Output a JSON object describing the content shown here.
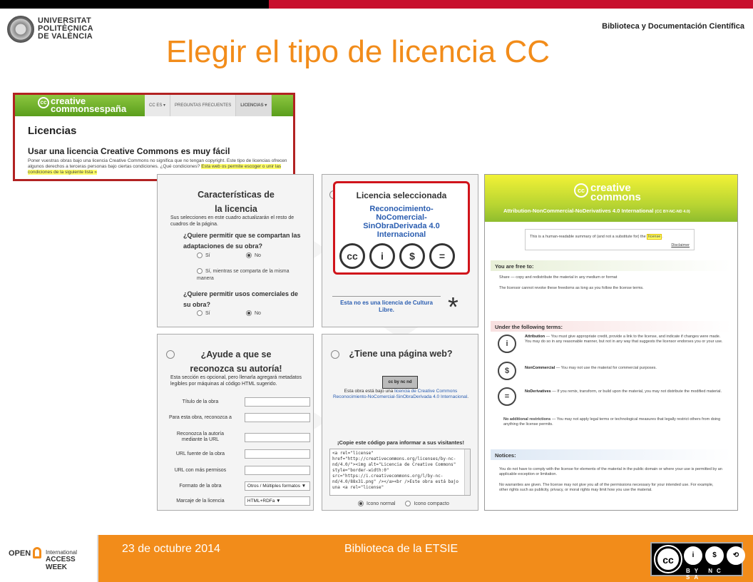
{
  "header": {
    "university": "UNIVERSITAT\nPOLITÈCNICA\nDE VALÈNCIA",
    "library": "Biblioteca y Documentación Científica",
    "title": "Elegir el tipo de licencia CC"
  },
  "ccspain": {
    "logo_top": "creative",
    "logo_bottom": "commonsespaña",
    "logo_cc": "cc",
    "tabs": [
      "CC ES",
      "PREGUNTAS FRECUENTES",
      "LICENCIAS"
    ],
    "heading": "Licencias",
    "subheading": "Usar una licencia Creative Commons es muy fácil",
    "body": "Poner vuestras obras bajo una licencia Creative Commons no significa que no tengan copyright. Este tipo de licencias ofrecen algunos derechos a terceras personas bajo ciertas condiciones. ¿Qué condiciones?",
    "highlight": "Esta web os permite escoger o unir las condiciones de la siguiente lista »"
  },
  "characteristics": {
    "title": "Características de la licencia",
    "intro": "Sus selecciones en este cuadro actualizarán el resto de cuadros de la página.",
    "q1": "¿Quiere permitir que se compartan las adaptaciones de su obra?",
    "q1_options": [
      "Sí",
      "No",
      "Sí, mientras se comparta de la misma manera"
    ],
    "q1_selected": "No",
    "q2": "¿Quiere permitir usos comerciales de su obra?",
    "q2_options": [
      "Sí",
      "No"
    ],
    "q2_selected": "No"
  },
  "selected": {
    "title": "Licencia seleccionada",
    "name": "Reconocimiento-NoComercial-SinObraDerivada 4.0 Internacional",
    "icons": [
      "cc",
      "by",
      "nc",
      "nd"
    ],
    "icon_glyphs": [
      "cc",
      "i",
      "$",
      "="
    ],
    "culture_note": "Esta no es una licencia de Cultura Libre.",
    "star": "*"
  },
  "authorship": {
    "title": "¿Ayude a que se reconozca su autoría!",
    "intro": "Esta sección es opcional, pero llenarla agregará metadatos legibles por máquinas al código HTML sugerido.",
    "fields": [
      {
        "label": "Título de la obra",
        "value": ""
      },
      {
        "label": "Para esta obra, reconozca a",
        "value": ""
      },
      {
        "label": "Reconozca la autoría mediante la URL",
        "value": ""
      },
      {
        "label": "URL fuente de la obra",
        "value": ""
      },
      {
        "label": "URL con más permisos",
        "value": ""
      },
      {
        "label": "Formato de la obra",
        "value": "Otros / Múltiples formatos ▼"
      },
      {
        "label": "Marcaje de la licencia",
        "value": "HTML+RDFa ▼"
      }
    ]
  },
  "website": {
    "title": "¿Tiene una página web?",
    "badge": "cc by nc nd",
    "text_prefix": "Esta obra está bajo una",
    "text_link": "licencia de Creative Commons Reconocimiento-NoComercial-SinObraDerivada 4.0 Internacional",
    "text_suffix": ".",
    "copy_label": "¡Copie este código para informar a sus visitantes!",
    "code": "<a rel=\"license\" href=\"http://creativecommons.org/licenses/by-nc-nd/4.0/\"><img alt=\"Licencia de Creative Commons\" style=\"border-width:0\" src=\"https://i.creativecommons.org/l/by-nc-nd/4.0/88x31.png\" /></a><br />Este obra está bajo una <a rel=\"license\"",
    "options": [
      "Icono normal",
      "Icono compacto"
    ],
    "selected_option": "Icono normal"
  },
  "deed": {
    "logo_top": "creative",
    "logo_bottom": "commons",
    "logo_cc": "cc",
    "license_name": "Attribution-NonCommercial-NoDerivatives 4.0 International",
    "license_code": "(CC BY-NC-ND 4.0)",
    "summary_text": "This is a human-readable summary of (and not a substitute for) the",
    "summary_link": "license",
    "disclaimer": "Disclaimer",
    "free_title": "You are free to:",
    "share": "Share — copy and redistribute the material in any medium or format",
    "revoke": "The licensor cannot revoke these freedoms as long as you follow the license terms.",
    "terms_title": "Under the following terms:",
    "terms": [
      {
        "glyph": "i",
        "name": "Attribution",
        "text": "— You must give appropriate credit, provide a link to the license, and indicate if changes were made. You may do so in any reasonable manner, but not in any way that suggests the licensor endorses you or your use."
      },
      {
        "glyph": "$",
        "name": "NonCommercial",
        "text": "— You may not use the material for commercial purposes."
      },
      {
        "glyph": "=",
        "name": "NoDerivatives",
        "text": "— If you remix, transform, or build upon the material, you may not distribute the modified material."
      }
    ],
    "no_additional": "No additional restrictions",
    "no_additional_text": "— You may not apply legal terms or technological measures that legally restrict others from doing anything the license permits.",
    "notices_title": "Notices:",
    "notice1": "You do not have to comply with the license for elements of the material in the public domain or where your use is permitted by an applicable exception or limitation.",
    "notice2": "No warranties are given. The license may not give you all of the permissions necessary for your intended use. For example, other rights such as publicity, privacy, or moral rights may limit how you use the material."
  },
  "footer": {
    "oaw_open": "OPEN",
    "oaw_international": "International",
    "oaw_access": "ACCESS WEEK",
    "date": "23 de octubre 2014",
    "library": "Biblioteca de la ETSIE",
    "cc_glyphs": [
      "cc",
      "i",
      "$",
      "⟲"
    ],
    "cc_labels": "BY NC SA"
  },
  "colors": {
    "accent": "#f28c1a",
    "cc_green": "#8cc63f",
    "highlight_red": "#d0141b",
    "link_blue": "#2a5db0"
  }
}
